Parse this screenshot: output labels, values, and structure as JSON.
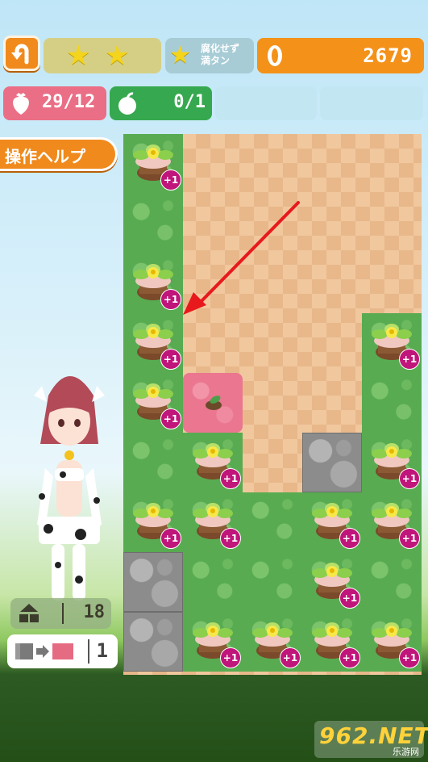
{
  "header": {
    "back_icon": "undo-arrow-icon",
    "stars": {
      "earned": 2,
      "icon": "star-icon"
    },
    "condition_label": "腐化せず\n満タン",
    "coins": "2679"
  },
  "resources": {
    "strawberry": {
      "icon": "strawberry-icon",
      "value": "29/12"
    },
    "apple": {
      "icon": "apple-icon",
      "value": "0/1"
    }
  },
  "help_button": {
    "label": "操作ヘルプ"
  },
  "board": {
    "plus_label": "+1",
    "cells": [
      {
        "col": 0,
        "row": 0,
        "type": "flower"
      },
      {
        "col": 0,
        "row": 1,
        "type": "grass"
      },
      {
        "col": 0,
        "row": 2,
        "type": "flower"
      },
      {
        "col": 0,
        "row": 3,
        "type": "flower"
      },
      {
        "col": 0,
        "row": 4,
        "type": "flower"
      },
      {
        "col": 0,
        "row": 5,
        "type": "grass"
      },
      {
        "col": 0,
        "row": 6,
        "type": "flower"
      },
      {
        "col": 0,
        "row": 7,
        "type": "rock"
      },
      {
        "col": 0,
        "row": 8,
        "type": "rock"
      },
      {
        "col": 1,
        "row": 4,
        "type": "pink"
      },
      {
        "col": 1,
        "row": 5,
        "type": "flower"
      },
      {
        "col": 1,
        "row": 6,
        "type": "flower"
      },
      {
        "col": 1,
        "row": 7,
        "type": "grass"
      },
      {
        "col": 1,
        "row": 8,
        "type": "flower"
      },
      {
        "col": 2,
        "row": 6,
        "type": "grass"
      },
      {
        "col": 2,
        "row": 7,
        "type": "grass"
      },
      {
        "col": 2,
        "row": 8,
        "type": "flower"
      },
      {
        "col": 3,
        "row": 5,
        "type": "rock"
      },
      {
        "col": 3,
        "row": 6,
        "type": "flower"
      },
      {
        "col": 3,
        "row": 7,
        "type": "flower"
      },
      {
        "col": 3,
        "row": 8,
        "type": "flower"
      },
      {
        "col": 4,
        "row": 3,
        "type": "flower"
      },
      {
        "col": 4,
        "row": 4,
        "type": "grass"
      },
      {
        "col": 4,
        "row": 5,
        "type": "flower"
      },
      {
        "col": 4,
        "row": 6,
        "type": "flower"
      },
      {
        "col": 4,
        "row": 7,
        "type": "grass"
      },
      {
        "col": 4,
        "row": 8,
        "type": "flower"
      }
    ]
  },
  "side": {
    "block_count": "18",
    "block_icon": "stacked-blocks-icon",
    "swap_count": "1",
    "swap_icon": "swap-block-icon"
  },
  "watermark": {
    "text": "962.NET",
    "subtext": "乐游网"
  },
  "colors": {
    "accent_orange": "#f08a1c",
    "coin_panel": "#f39119",
    "strawberry_panel": "#ea6e85",
    "apple_panel": "#36a84f"
  }
}
